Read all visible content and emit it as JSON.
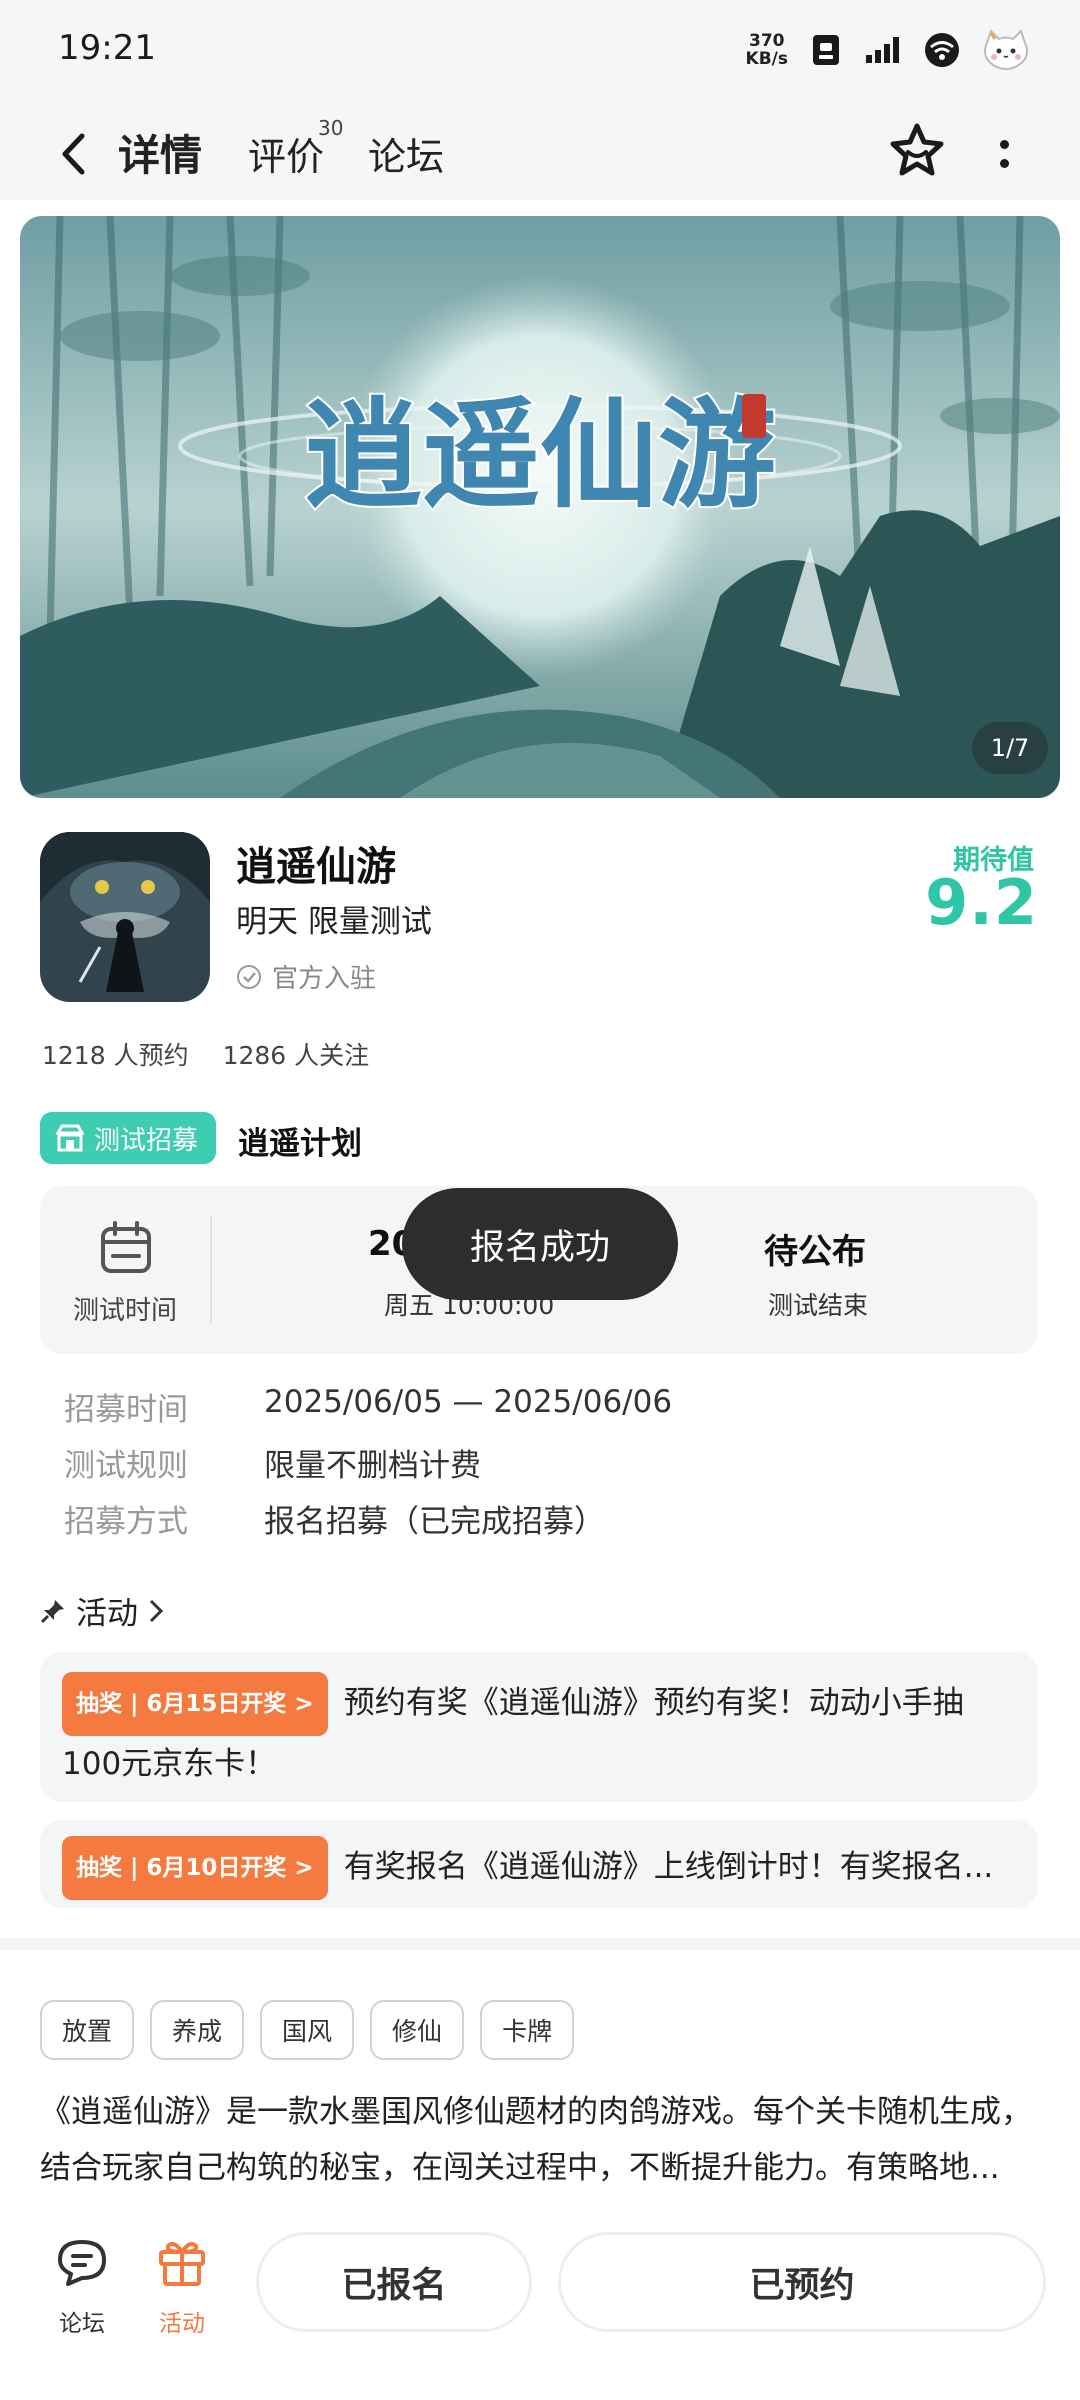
{
  "status_bar": {
    "time": "19:21",
    "net_speed_value": "370",
    "net_speed_unit": "KB/s"
  },
  "nav": {
    "tabs": [
      {
        "label": "详情"
      },
      {
        "label": "评价"
      },
      {
        "label": "论坛"
      }
    ],
    "review_count": "30"
  },
  "banner": {
    "title_art": "逍遥仙游",
    "counter": "1/7"
  },
  "game": {
    "name": "逍遥仙游",
    "status": "明天 限量测试",
    "official": "官方入驻",
    "expect_label": "期待值",
    "expect_score": "9.2",
    "reservations": "1218 人预约",
    "followers": "1286 人关注"
  },
  "recruit": {
    "tag": "测试招募",
    "plan": "逍遥计划",
    "card": {
      "time_label": "测试时间",
      "start_date": "20",
      "start_day": "周五 10:00:00",
      "end_status": "待公布",
      "end_label": "测试结束"
    },
    "toast": "报名成功",
    "info": [
      {
        "label": "招募时间",
        "value": "2025/06/05 — 2025/06/06"
      },
      {
        "label": "测试规则",
        "value": "限量不删档计费"
      },
      {
        "label": "招募方式",
        "value": "报名招募（已完成招募）"
      }
    ]
  },
  "activities": {
    "header": "活动",
    "items": [
      {
        "pill": "抽奖 | 6月15日开奖 >",
        "text": "预约有奖《逍遥仙游》预约有奖！动动小手抽100元京东卡！"
      },
      {
        "pill": "抽奖 | 6月10日开奖 >",
        "text": "有奖报名《逍遥仙游》上线倒计时！有奖报名..."
      }
    ]
  },
  "tags": [
    "放置",
    "养成",
    "国风",
    "修仙",
    "卡牌"
  ],
  "description": {
    "line1": "《逍遥仙游》是一款水墨国风修仙题材的肉鸽游戏。每个关卡随机生成，",
    "line2": "结合玩家自己构筑的秘宝，在闯关过程中，不断提升能力。有策略地..."
  },
  "bottom_bar": {
    "forum_label": "论坛",
    "activity_label": "活动",
    "signed_up_button": "已报名",
    "reserved_button": "已预约"
  },
  "colors": {
    "accent_green": "#2ec6a6",
    "accent_orange": "#f47a3f",
    "toast_bg": "#2d2d2d"
  }
}
